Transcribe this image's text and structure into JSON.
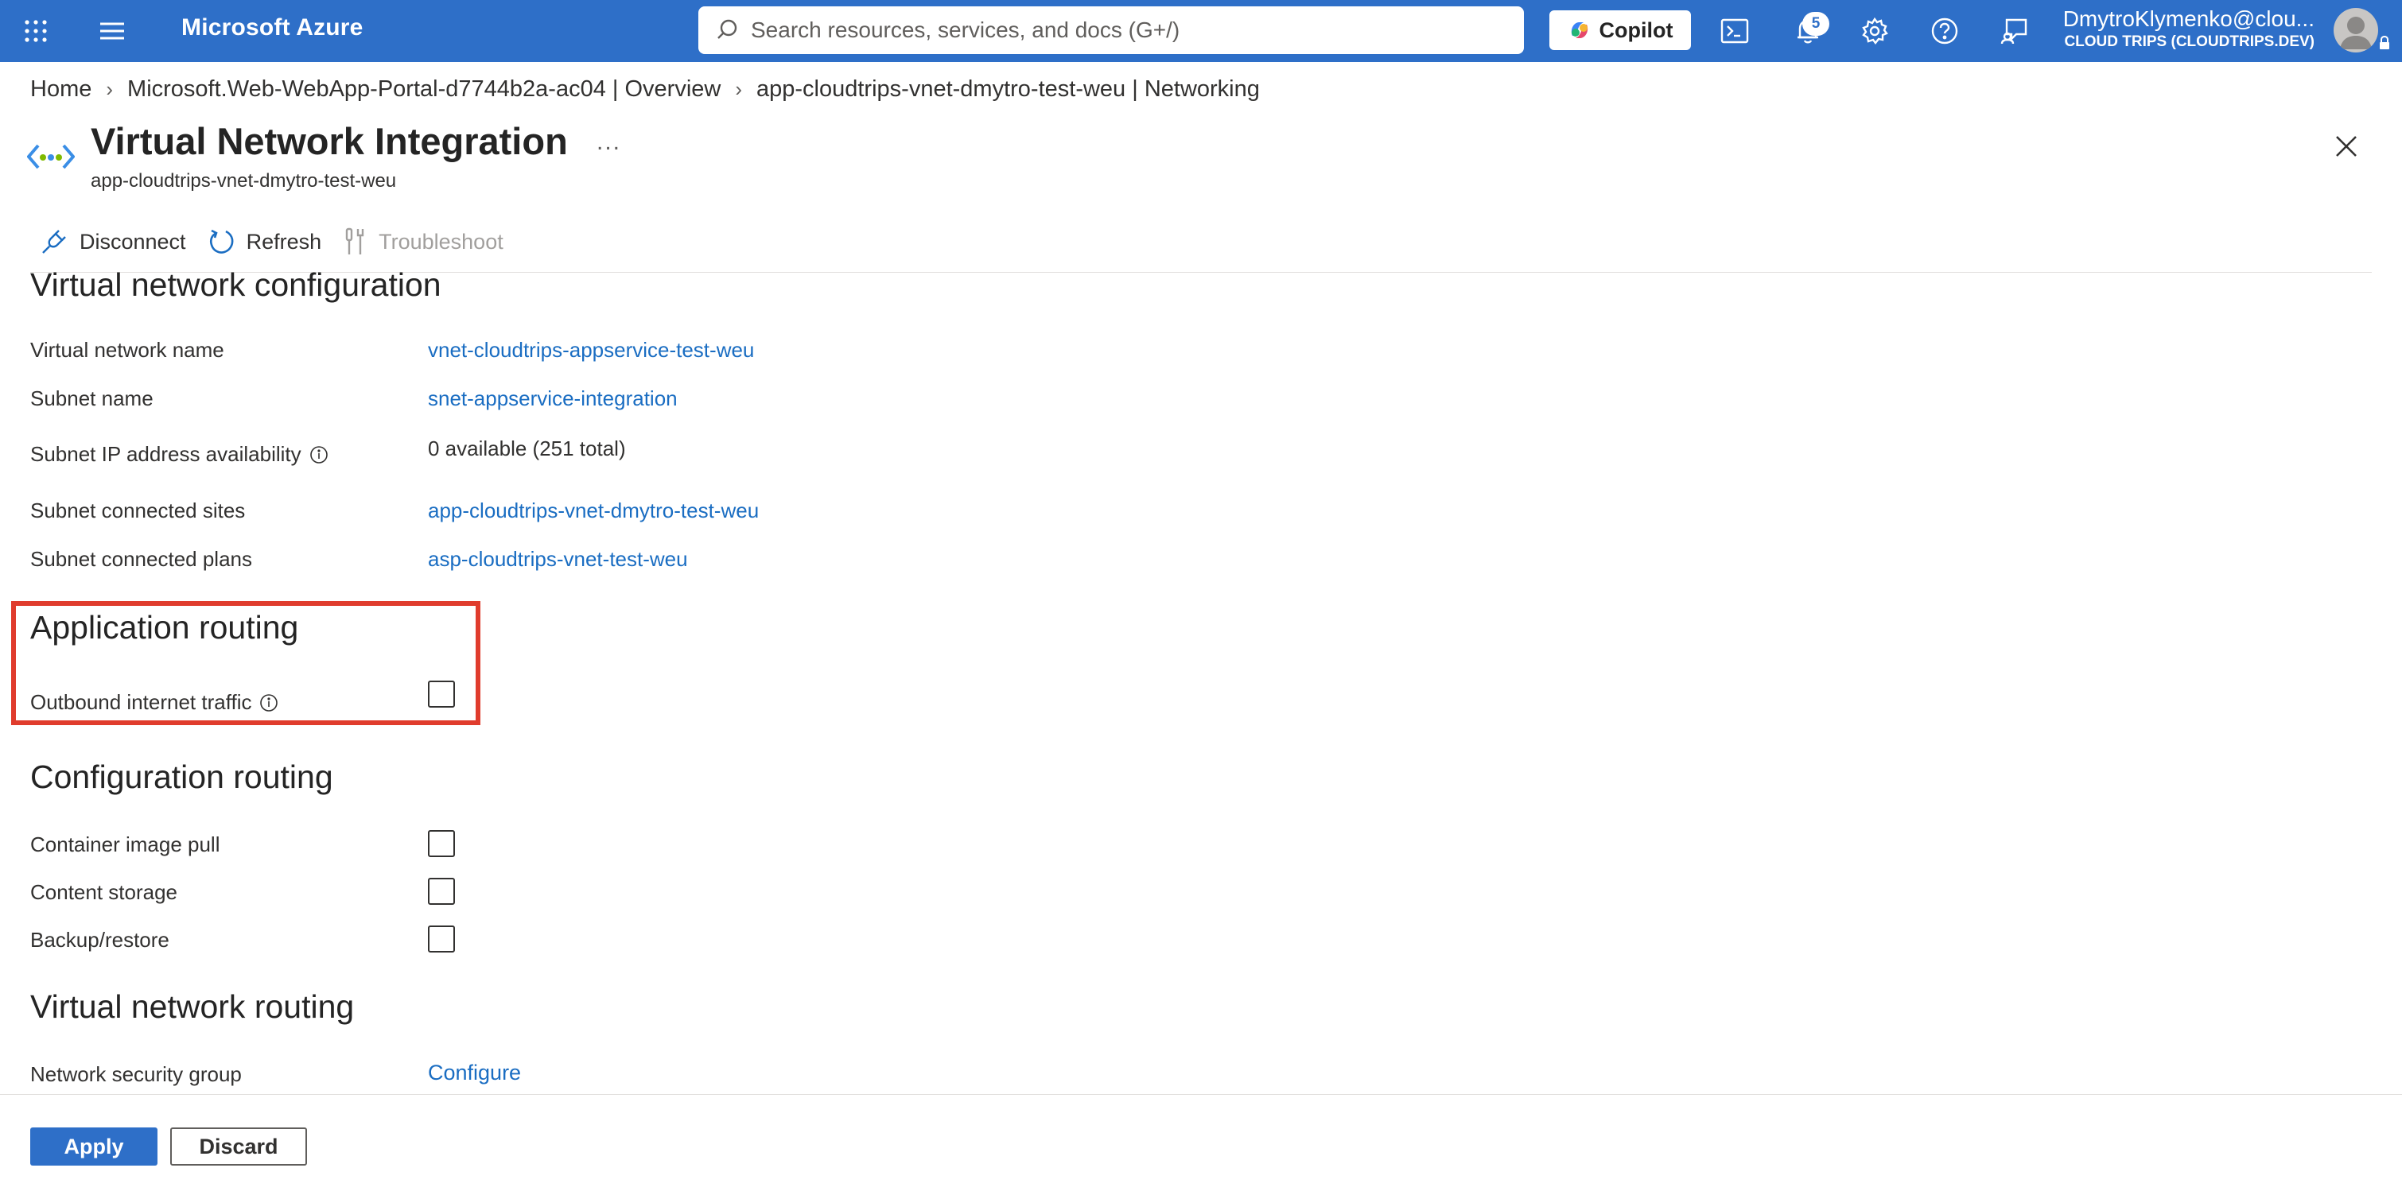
{
  "topbar": {
    "brand": "Microsoft Azure",
    "search_placeholder": "Search resources, services, and docs (G+/)",
    "copilot_label": "Copilot",
    "notification_count": "5",
    "user_name": "DmytroKlymenko@clou...",
    "user_tenant": "CLOUD TRIPS (CLOUDTRIPS.DEV)",
    "bar_color": "#2e6fc8"
  },
  "breadcrumb": [
    "Home",
    "Microsoft.Web-WebApp-Portal-d7744b2a-ac04 | Overview",
    "app-cloudtrips-vnet-dmytro-test-weu | Networking"
  ],
  "header": {
    "title": "Virtual Network Integration",
    "more_label": "...",
    "subtitle": "app-cloudtrips-vnet-dmytro-test-weu"
  },
  "toolbar": {
    "disconnect": "Disconnect",
    "refresh": "Refresh",
    "troubleshoot": "Troubleshoot"
  },
  "vnet_config": {
    "heading": "Virtual network configuration",
    "rows": [
      {
        "label": "Virtual network name",
        "value": "vnet-cloudtrips-appservice-test-weu"
      },
      {
        "label": "Subnet name",
        "value": "snet-appservice-integration"
      },
      {
        "label": "Subnet IP address availability",
        "value": "0 available (251 total)"
      },
      {
        "label": "Subnet connected sites",
        "value": "app-cloudtrips-vnet-dmytro-test-weu"
      },
      {
        "label": "Subnet connected plans",
        "value": "asp-cloudtrips-vnet-test-weu"
      }
    ]
  },
  "app_routing": {
    "heading": "Application routing",
    "outbound_label": "Outbound internet traffic",
    "outbound_checked": false
  },
  "config_routing": {
    "heading": "Configuration routing",
    "items": [
      {
        "label": "Container image pull",
        "checked": false
      },
      {
        "label": "Content storage",
        "checked": false
      },
      {
        "label": "Backup/restore",
        "checked": false
      }
    ]
  },
  "vnet_routing": {
    "heading": "Virtual network routing",
    "nsg_label": "Network security group",
    "nsg_value": "Configure"
  },
  "footer": {
    "apply": "Apply",
    "discard": "Discard"
  },
  "colors": {
    "accent": "#2e6fc8",
    "link": "#1a6dc2",
    "highlight": "#e03c2d"
  }
}
